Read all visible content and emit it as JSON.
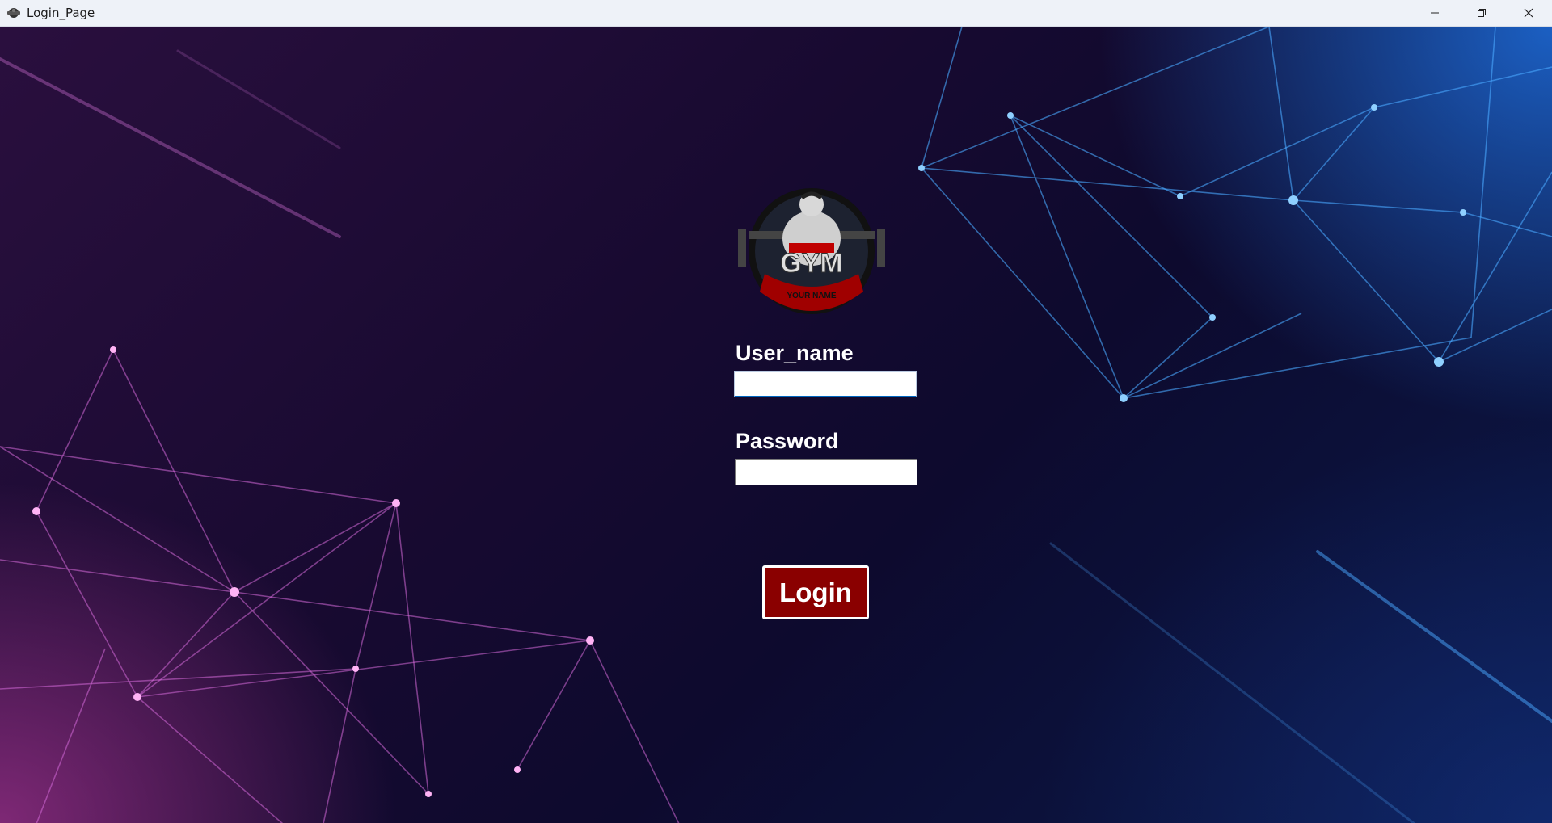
{
  "window": {
    "title": "Login_Page",
    "app_icon": "gym-logo-icon",
    "controls": [
      "minimize-icon",
      "restore-icon",
      "close-icon"
    ]
  },
  "logo": {
    "icon": "gym-mascot-logo",
    "text": "GYM",
    "subtext": "YOUR NAME"
  },
  "form": {
    "username_label": "User_name",
    "username_value": "",
    "password_label": "Password",
    "password_value": "",
    "login_label": "Login"
  },
  "colors": {
    "login_button": "#8a0000",
    "label_text": "#ffffff",
    "focus_accent": "#0067c0"
  }
}
